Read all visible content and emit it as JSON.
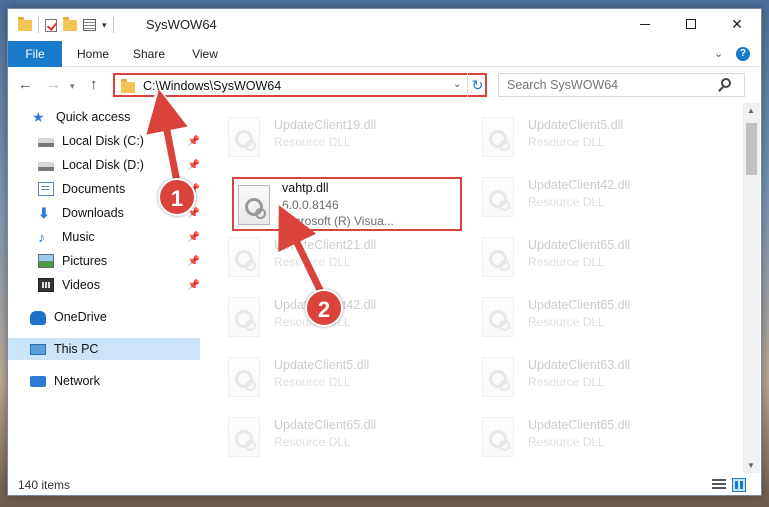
{
  "window": {
    "title": "SysWOW64"
  },
  "ribbon": {
    "tabs": [
      "File",
      "Home",
      "Share",
      "View"
    ],
    "help_label": "?"
  },
  "address": {
    "path": "C:\\Windows\\SysWOW64"
  },
  "search": {
    "placeholder": "Search SysWOW64"
  },
  "sidebar": {
    "items": [
      {
        "label": "Quick access",
        "icon": "star-icon"
      },
      {
        "label": "Local Disk (C:)",
        "icon": "drive-icon",
        "pinned": true
      },
      {
        "label": "Local Disk (D:)",
        "icon": "drive-icon",
        "pinned": true
      },
      {
        "label": "Documents",
        "icon": "documents-icon",
        "pinned": true
      },
      {
        "label": "Downloads",
        "icon": "download-icon",
        "pinned": true
      },
      {
        "label": "Music",
        "icon": "music-icon",
        "pinned": true
      },
      {
        "label": "Pictures",
        "icon": "pictures-icon",
        "pinned": true
      },
      {
        "label": "Videos",
        "icon": "videos-icon",
        "pinned": true
      },
      {
        "label": "OneDrive",
        "icon": "cloud-icon"
      },
      {
        "label": "This PC",
        "icon": "computer-icon",
        "selected": true
      },
      {
        "label": "Network",
        "icon": "network-icon"
      }
    ]
  },
  "files": {
    "left": [
      {
        "name": "UpdateClient19.dll",
        "line2": "Resource DLL"
      },
      {
        "name": "vahtp.dll",
        "line2": "6.0.0.8146",
        "line3": "Microsoft (R) Visua...",
        "highlighted": true
      },
      {
        "name": "UpdateClient21.dll",
        "line2": "Resource DLL"
      },
      {
        "name": "UpdateClient42.dll",
        "line2": "Resource DLL"
      },
      {
        "name": "UpdateClient5.dll",
        "line2": "Resource DLL"
      },
      {
        "name": "UpdateClient65.dll",
        "line2": "Resource DLL"
      }
    ],
    "right": [
      {
        "name": "UpdateClient5.dll",
        "line2": "Resource DLL"
      },
      {
        "name": "UpdateClient42.dll",
        "line2": "Resource DLL"
      },
      {
        "name": "UpdateClient65.dll",
        "line2": "Resource DLL"
      },
      {
        "name": "UpdateClient65.dll",
        "line2": "Resource DLL"
      },
      {
        "name": "UpdateClient63.dll",
        "line2": "Resource DLL"
      },
      {
        "name": "UpdateClient65.dll",
        "line2": "Resource DLL"
      }
    ]
  },
  "status": {
    "item_count": "140 items"
  },
  "annotations": {
    "step1": "1",
    "step2": "2",
    "color": "#d9433b"
  }
}
